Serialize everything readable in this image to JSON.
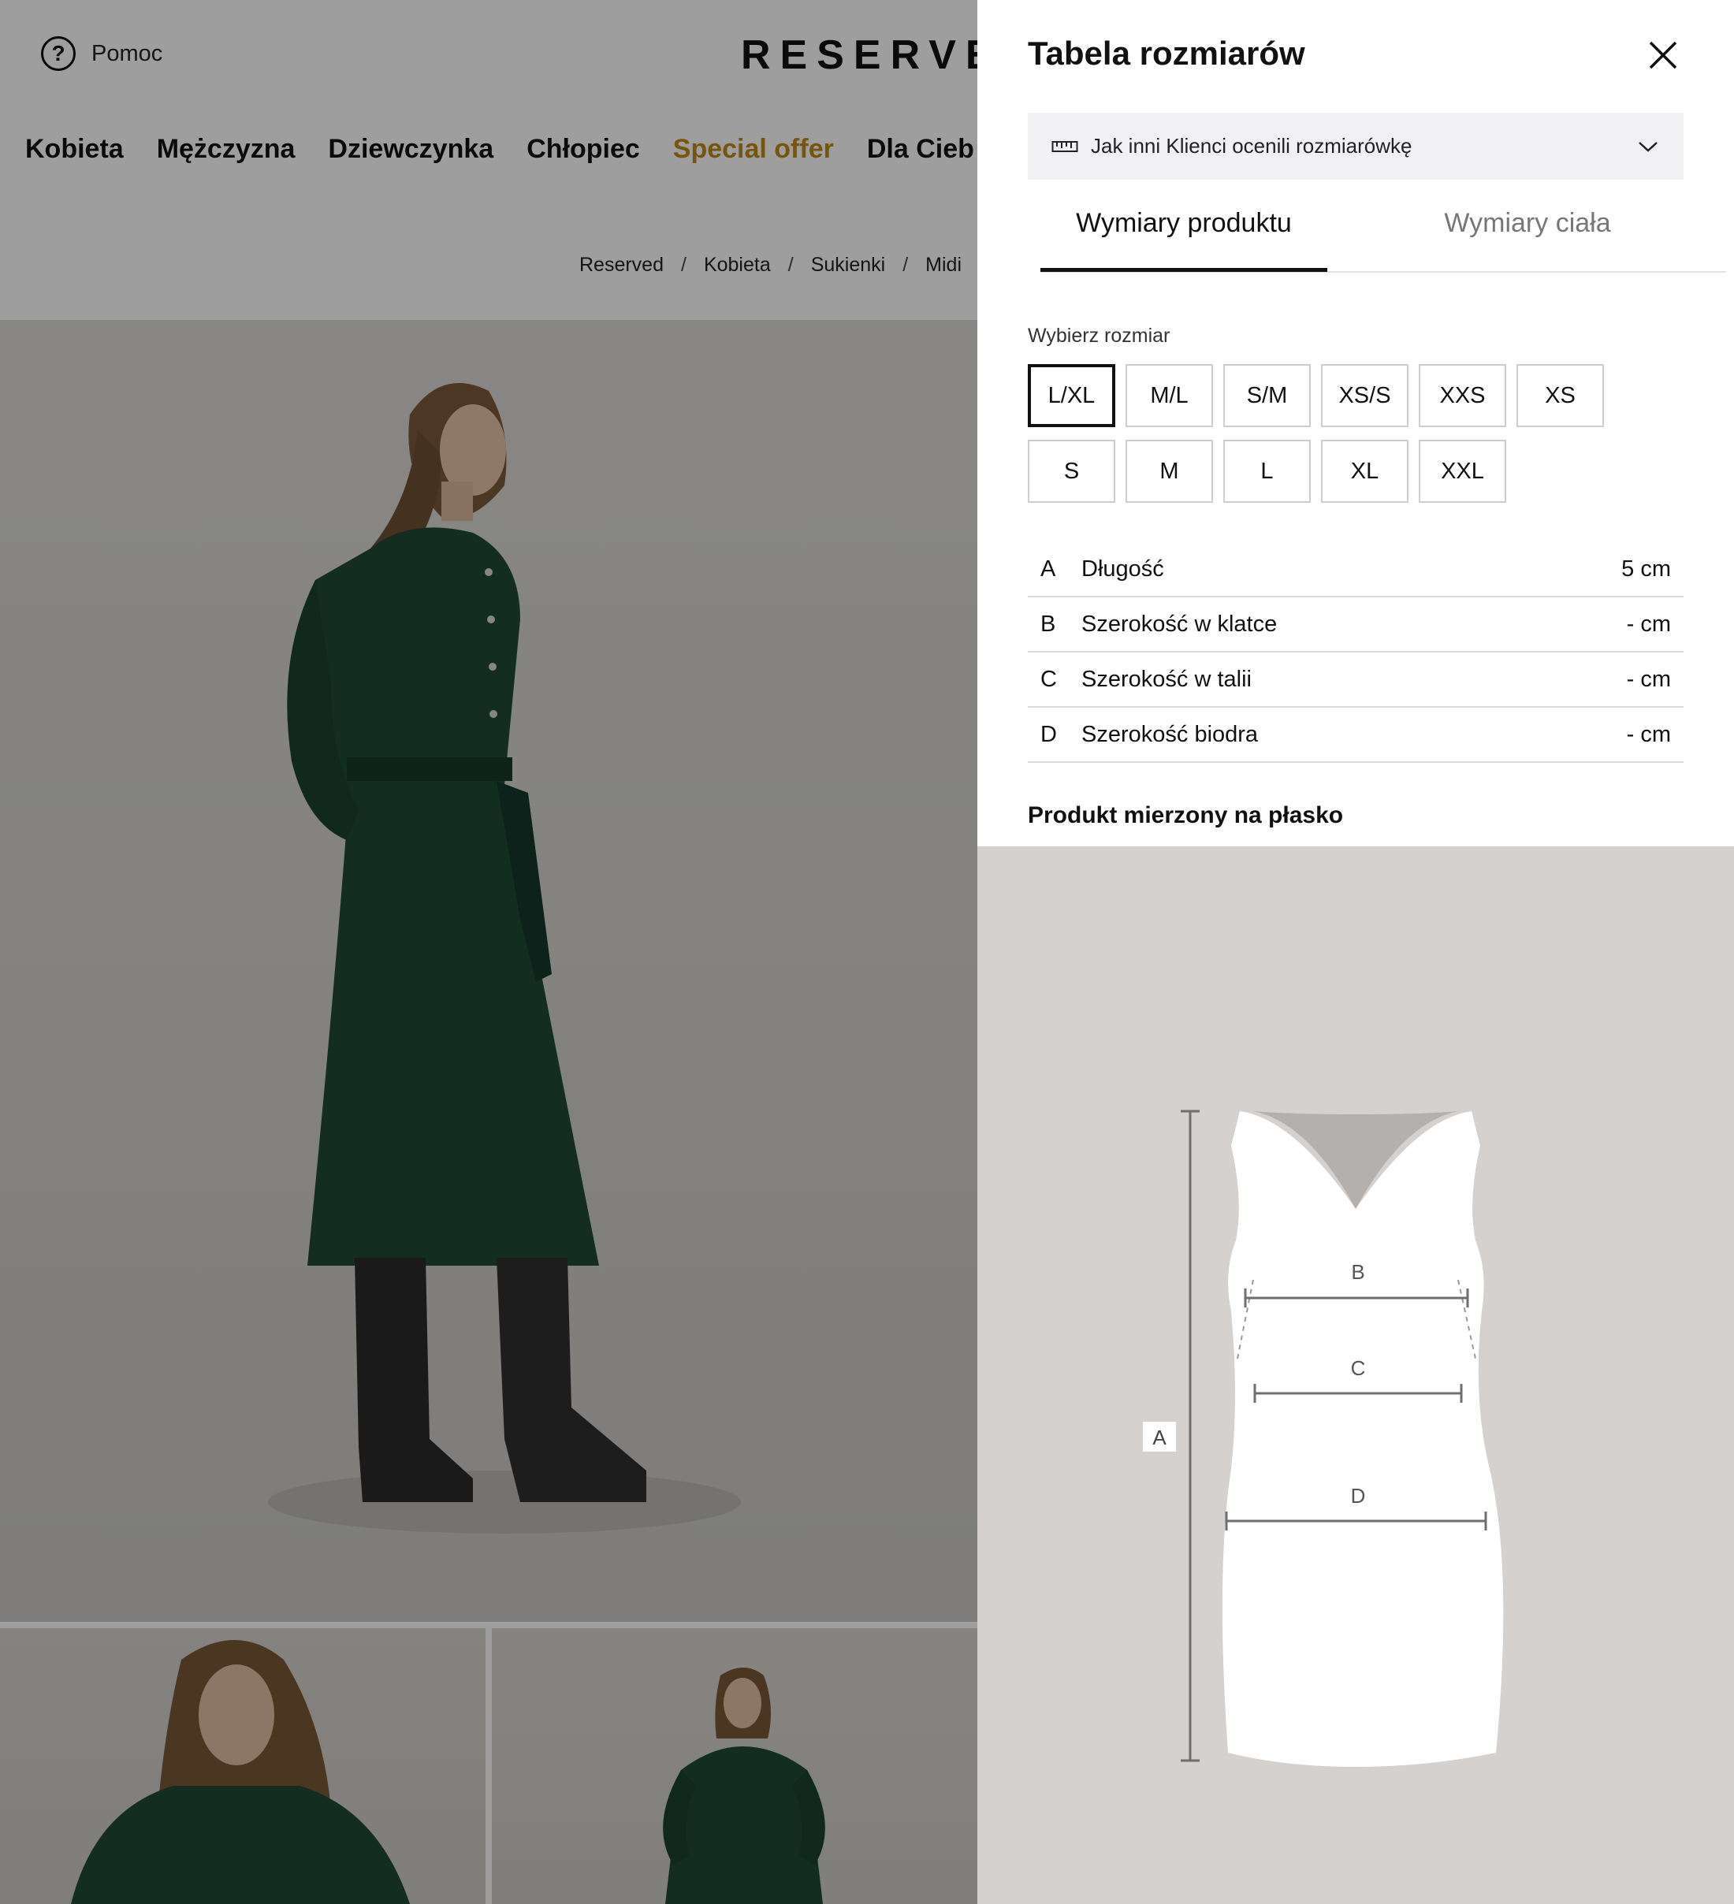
{
  "header": {
    "help_label": "Pomoc",
    "logo": "RESERVE"
  },
  "nav": {
    "items": [
      {
        "label": "Kobieta"
      },
      {
        "label": "Mężczyzna"
      },
      {
        "label": "Dziewczynka"
      },
      {
        "label": "Chłopiec"
      },
      {
        "label": "Special offer"
      },
      {
        "label": "Dla Cieb"
      }
    ]
  },
  "breadcrumb": {
    "items": [
      "Reserved",
      "Kobieta",
      "Sukienki",
      "Midi"
    ],
    "separator": "/"
  },
  "size_chart": {
    "title": "Tabela rozmiarów",
    "accordion_label": "Jak inni Klienci ocenili rozmiarówkę",
    "tabs": [
      {
        "label": "Wymiary produktu",
        "active": true
      },
      {
        "label": "Wymiary ciała",
        "active": false
      }
    ],
    "size_label": "Wybierz rozmiar",
    "sizes": [
      "L/XL",
      "M/L",
      "S/M",
      "XS/S",
      "XXS",
      "XS",
      "S",
      "M",
      "L",
      "XL",
      "XXL"
    ],
    "selected_size": "L/XL",
    "measurements": [
      {
        "letter": "A",
        "name": "Długość",
        "value": "5 cm"
      },
      {
        "letter": "B",
        "name": "Szerokość w klatce",
        "value": "- cm"
      },
      {
        "letter": "C",
        "name": "Szerokość w talii",
        "value": "- cm"
      },
      {
        "letter": "D",
        "name": "Szerokość biodra",
        "value": "- cm"
      }
    ],
    "flat_note": "Produkt mierzony na płasko",
    "diagram_labels": {
      "a": "A",
      "b": "B",
      "c": "C",
      "d": "D"
    }
  },
  "colors": {
    "accent": "#c08a14",
    "dress": "#1f4a35",
    "overlay": "rgba(0,0,0,0.38)",
    "drawer_bg": "#ffffff",
    "diagram_bg": "#d4d1ce"
  }
}
